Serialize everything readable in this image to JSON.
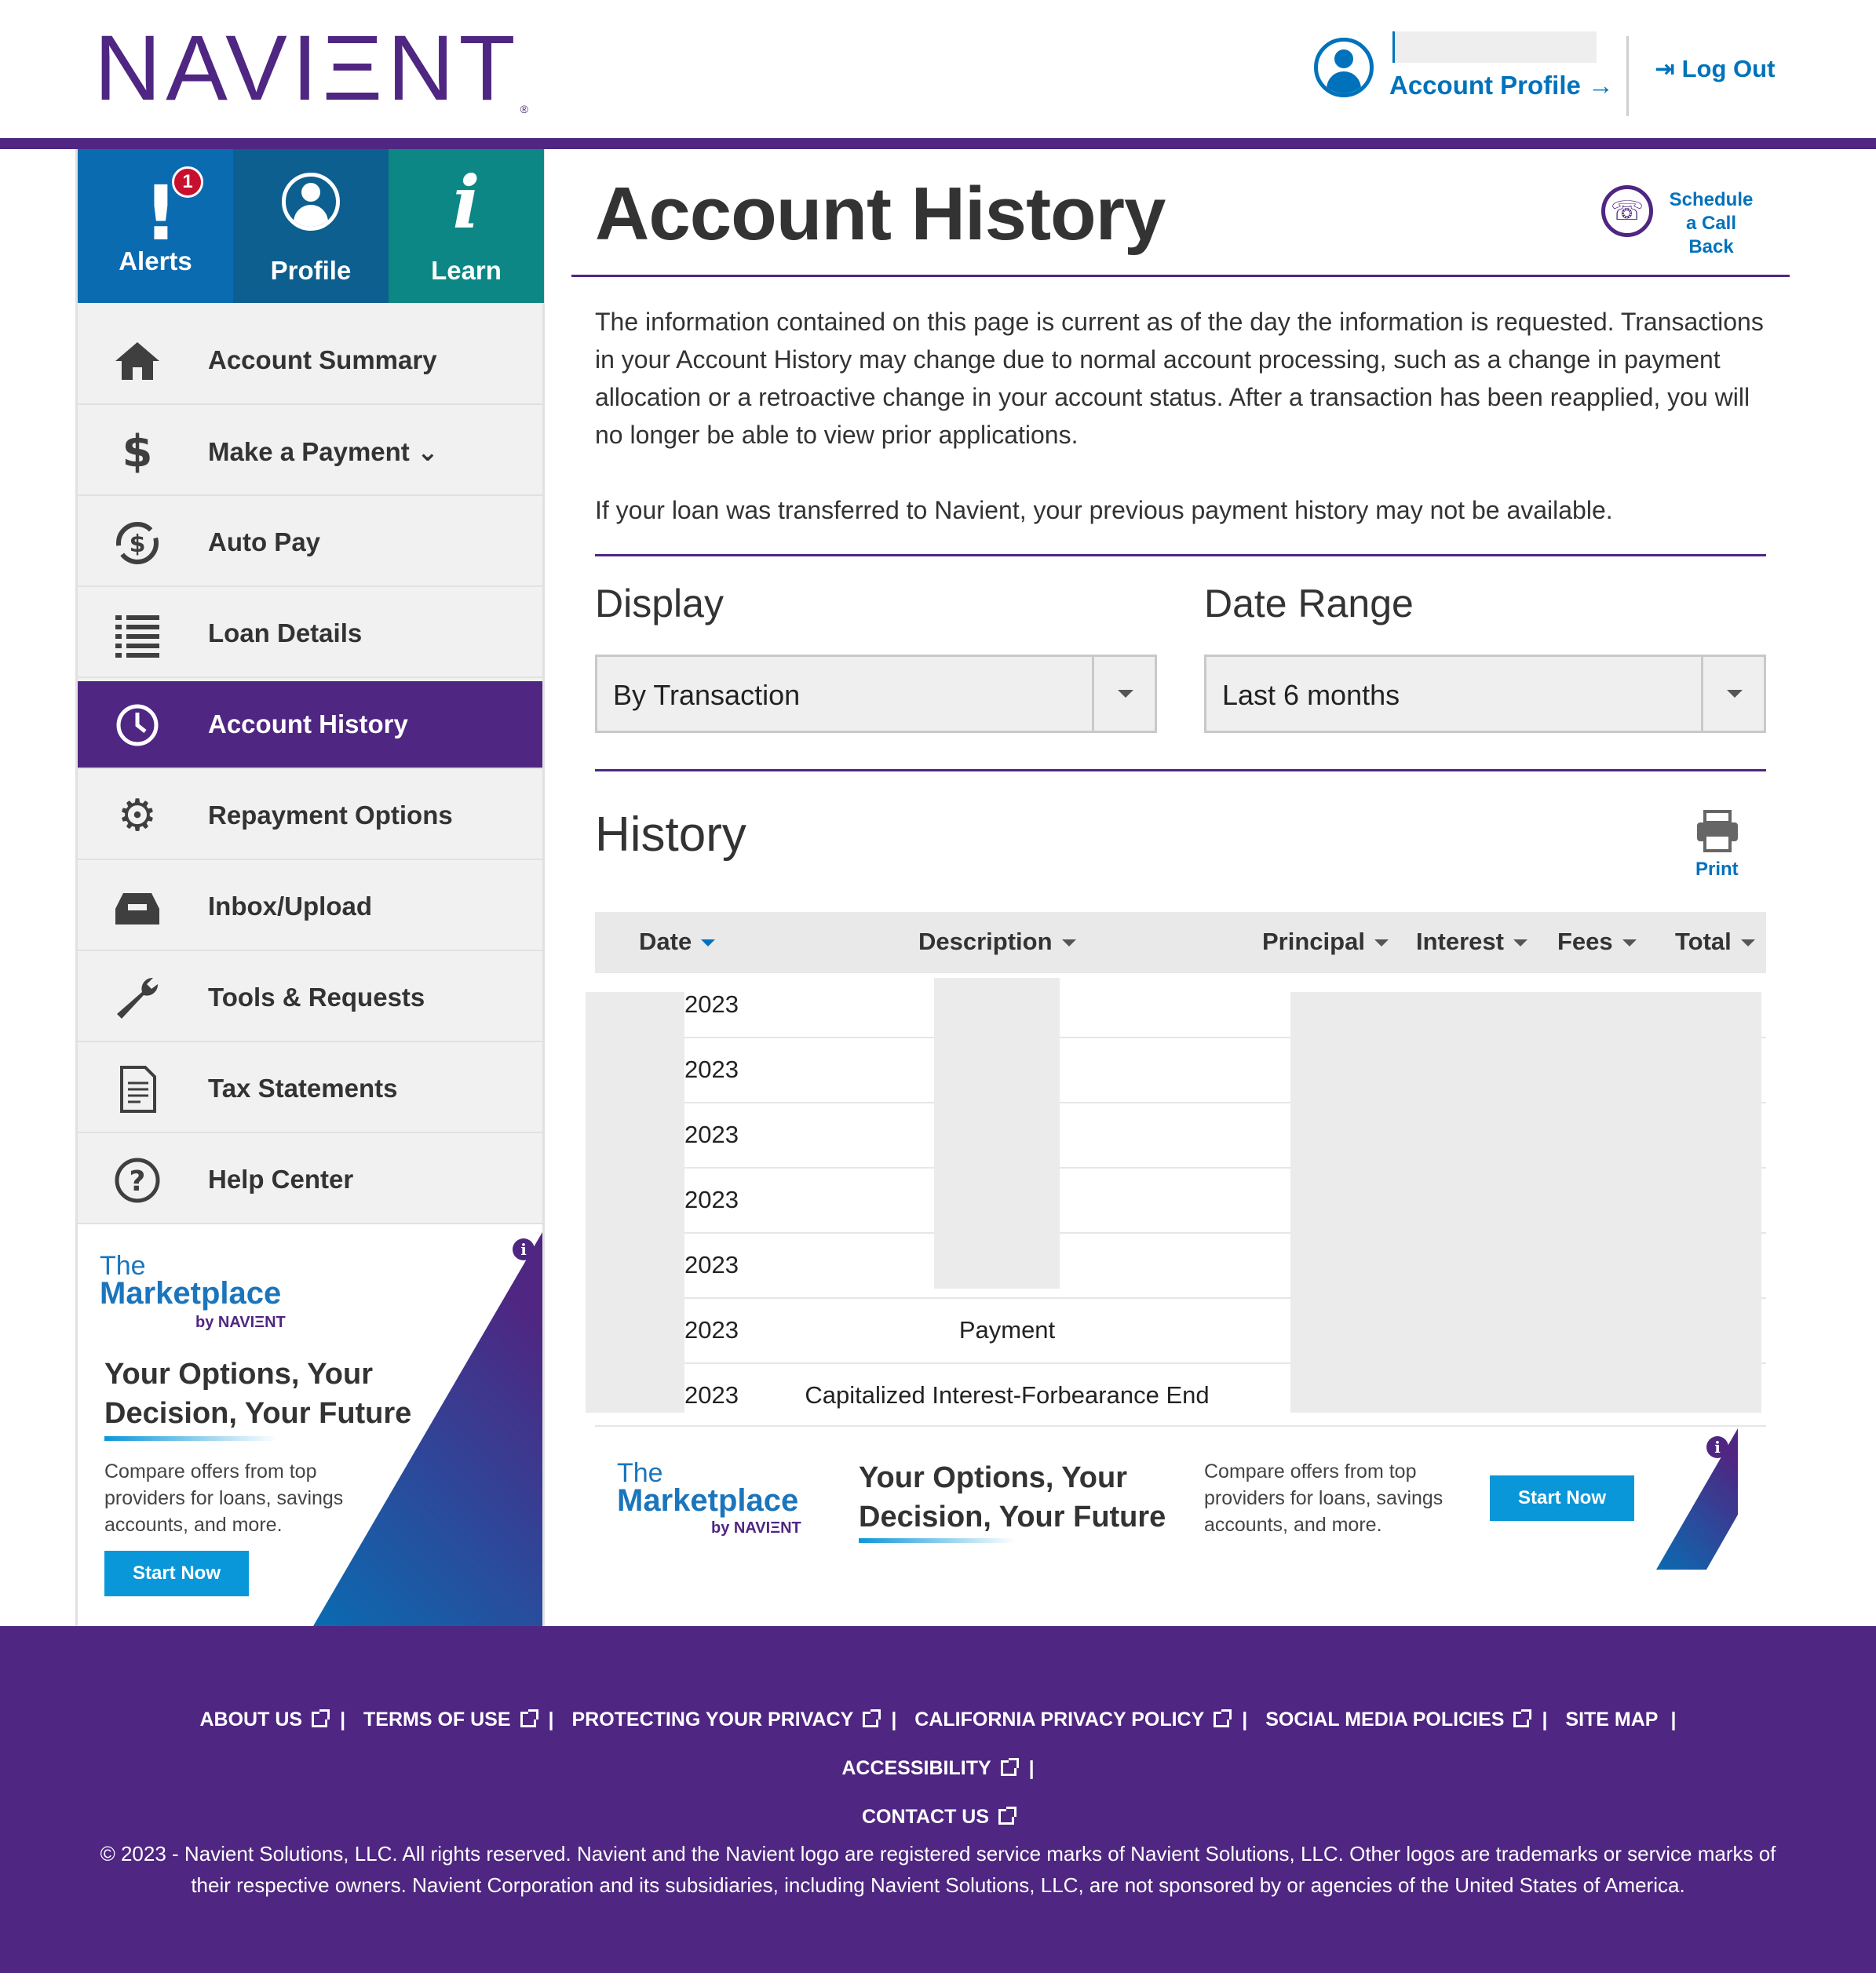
{
  "header": {
    "logo_text": "NAVIΞNT",
    "account_profile": "Account Profile →",
    "logout": "Log Out"
  },
  "tiles": [
    {
      "label": "Alerts",
      "badge": "1"
    },
    {
      "label": "Profile"
    },
    {
      "label": "Learn"
    }
  ],
  "nav": [
    {
      "label": "Account Summary",
      "icon": "home-icon"
    },
    {
      "label": "Make a Payment ⌄",
      "icon": "dollar-icon"
    },
    {
      "label": "Auto Pay",
      "icon": "autopay-icon"
    },
    {
      "label": "Loan Details",
      "icon": "list-icon"
    },
    {
      "label": "Account History",
      "icon": "clock-history-icon"
    },
    {
      "label": "Repayment Options",
      "icon": "gear-icon"
    },
    {
      "label": "Inbox/Upload",
      "icon": "inbox-icon"
    },
    {
      "label": "Tools & Requests",
      "icon": "wrench-icon"
    },
    {
      "label": "Tax Statements",
      "icon": "document-icon"
    },
    {
      "label": "Help Center",
      "icon": "question-icon"
    }
  ],
  "marketplace": {
    "the": "The",
    "name": "Marketplace",
    "by": "by NAVIΞNT",
    "title": "Your Options, Your Decision, Your Future",
    "description": "Compare offers from top providers for loans, savings accounts, and more.",
    "button": "Start Now",
    "info": "i"
  },
  "main": {
    "title": "Account History",
    "callback": "Schedule a Call Back",
    "intro_1": "The information contained on this page is current as of the day the information is requested. Transactions in your Account History may change due to normal account processing, such as a change in payment allocation or a retroactive change in your account status. After a transaction has been reapplied, you will no longer be able to view prior applications.",
    "intro_2": "If your loan was transferred to Navient, your previous payment history may not be available.",
    "display_label": "Display",
    "display_value": "By Transaction",
    "date_range_label": "Date Range",
    "date_range_value": "Last 6 months",
    "history_title": "History",
    "print": "Print"
  },
  "table": {
    "columns": [
      "Date",
      "Description",
      "Principal",
      "Interest",
      "Fees",
      "Total"
    ],
    "rows": [
      {
        "date": "2023",
        "description": ""
      },
      {
        "date": "2023",
        "description": ""
      },
      {
        "date": "2023",
        "description": ""
      },
      {
        "date": "2023",
        "description": ""
      },
      {
        "date": "2023",
        "description": ""
      },
      {
        "date": "2023",
        "description": "Payment"
      },
      {
        "date": "2023",
        "description": "Capitalized Interest-Forbearance End"
      }
    ]
  },
  "footer": {
    "links": [
      "ABOUT US",
      "TERMS OF USE",
      "PROTECTING YOUR PRIVACY",
      "CALIFORNIA PRIVACY POLICY",
      "SOCIAL MEDIA POLICIES",
      "SITE MAP",
      "ACCESSIBILITY",
      "CONTACT US"
    ],
    "legal": "© 2023 - Navient Solutions, LLC. All rights reserved. Navient and the Navient logo are registered service marks of Navient Solutions, LLC. Other logos are trademarks or service marks of their respective owners. Navient Corporation and its subsidiaries, including Navient Solutions, LLC, are not sponsored by or agencies of the United States of America."
  },
  "colors": {
    "brand_purple": "#4f2682",
    "link_blue": "#0072bc",
    "alerts_tile": "#0a6bb1",
    "profile_tile": "#0c5f8e",
    "learn_tile": "#0c8785",
    "cta_blue": "#0a97d9"
  }
}
